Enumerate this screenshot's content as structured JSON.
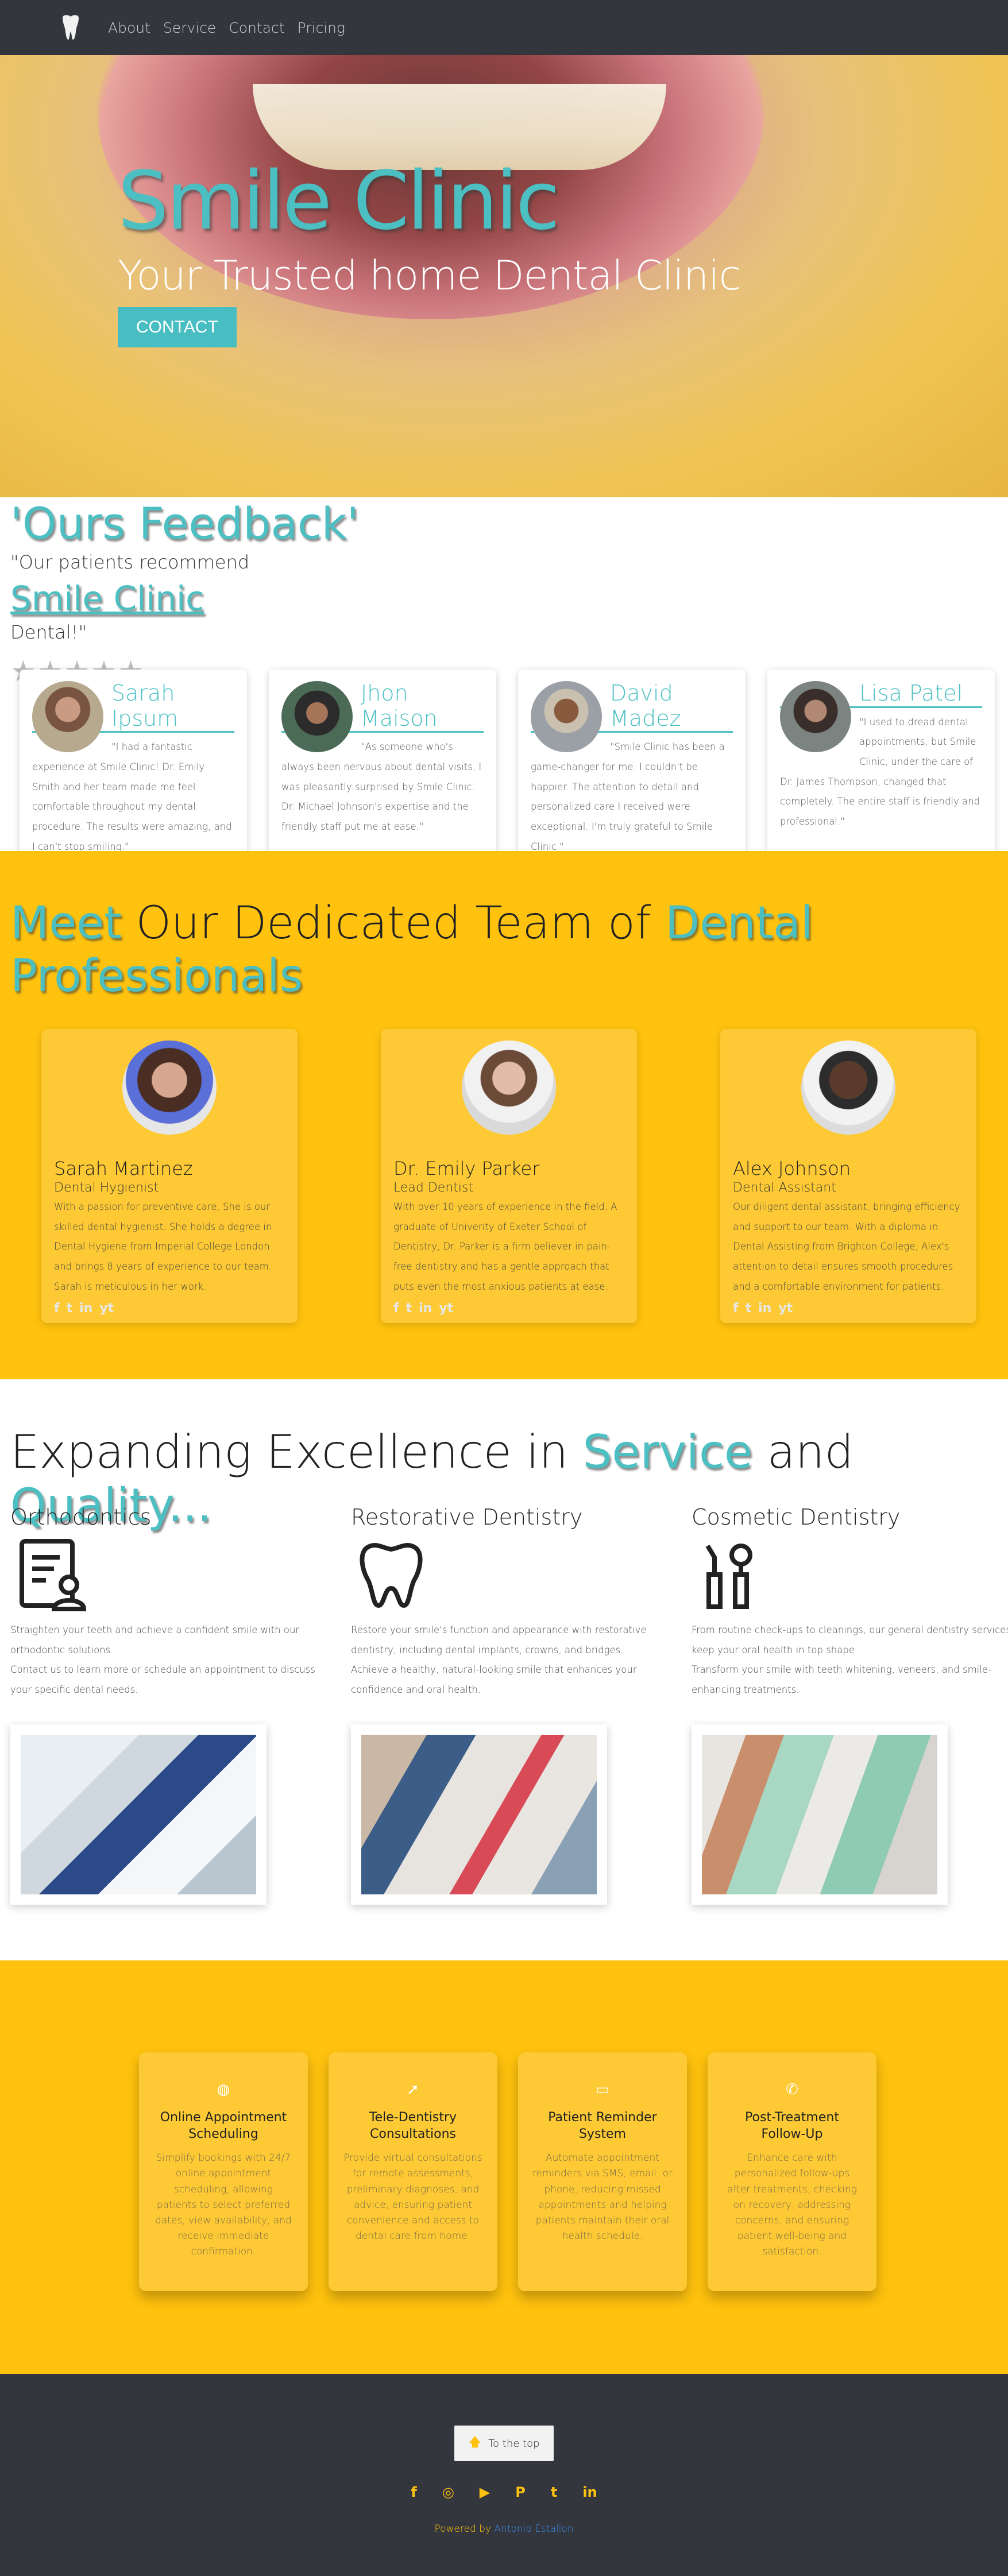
{
  "nav": {
    "logo": "tooth-logo",
    "links": [
      "About",
      "Service",
      "Contact",
      "Pricing"
    ]
  },
  "hero": {
    "title": "Smile Clinic",
    "subtitle": "Your Trusted home Dental Clinic",
    "cta": "CONTACT"
  },
  "feedback": {
    "title": "'Ours Feedback'",
    "recommend": "\"Our patients recommend",
    "brand": "Smile Clinic",
    "dental": "Dental!\"",
    "stars": "★★★★★",
    "reviews": [
      {
        "name": "Sarah Ipsum",
        "text": "\"I had a fantastic experience at Smile Clinic! Dr. Emily Smith and her team made me feel comfortable throughout my dental procedure. The results were amazing, and I can't stop smiling.\""
      },
      {
        "name": "Jhon Maison",
        "text": "\"As someone who's always been nervous about dental visits, I was pleasantly surprised by Smile Clinic. Dr. Michael Johnson's expertise and the friendly staff put me at ease.\""
      },
      {
        "name": "David Madez",
        "text": "\"Smile Clinic has been a game-changer for me. I couldn't be happier. The attention to detail and personalized care I received were exceptional. I'm truly grateful to Smile Clinic.\""
      },
      {
        "name": "Lisa Patel",
        "text": "\"I used to dread dental appointments, but Smile Clinic, under the care of Dr. James Thompson, changed that completely. The entire staff is friendly and professional.\""
      }
    ]
  },
  "team": {
    "title_meet": "Meet",
    "title_mid": "Our Dedicated Team of",
    "title_dental": "Dental",
    "title_pro": "Professionals",
    "members": [
      {
        "name": "Sarah Martinez",
        "role": "Dental Hygienist",
        "bio": "With a passion for preventive care, She is our skilled dental hygienist. She holds a degree in Dental Hygiene from Imperial College London and brings 8 years of experience to our team. Sarah is meticulous in her work."
      },
      {
        "name": "Dr. Emily Parker",
        "role": "Lead Dentist",
        "bio": "With over 10 years of experience in the field. A graduate of Univerity of Exeter School of Dentistry, Dr. Parker is a firm believer in pain-free dentistry and has a gentle approach that puts even the most anxious patients at ease."
      },
      {
        "name": "Alex Johnson",
        "role": "Dental Assistant",
        "bio": "Our diligent dental assistant, bringing efficiency and support to our team. With a diploma in Dental Assisting from Brighton College, Alex's attention to detail ensures smooth procedures and a comfortable environment for patients."
      }
    ],
    "socials": [
      "f",
      "t",
      "in",
      "yt"
    ]
  },
  "services": {
    "title_a": "Expanding Excellence in",
    "title_service": "Service",
    "title_and": "and",
    "title_quality": "Quality...",
    "cols": [
      {
        "title": "Orthodontics",
        "icon": "clipboard-user-icon",
        "p1": "Straighten your teeth and achieve a confident smile with our orthodontic solutions.",
        "p2": "Contact us to learn more or schedule an appointment to discuss your specific dental needs."
      },
      {
        "title": "Restorative Dentistry",
        "icon": "tooth-icon",
        "p1": "Restore your smile's function and appearance with restorative dentistry, including dental implants, crowns, and bridges.",
        "p2": "Achieve a healthy, natural-looking smile that enhances your confidence and oral health."
      },
      {
        "title": "Cosmetic Dentistry",
        "icon": "dental-tools-icon",
        "p1": "From routine check-ups to cleanings, our general dentistry services keep your oral health in top shape.",
        "p2": "Transform your smile with teeth whitening, veneers, and smile-enhancing treatments."
      }
    ]
  },
  "features": [
    {
      "icon": "globe-icon",
      "glyph": "◍",
      "title": "Online Appointment Scheduling",
      "text": "Simplify bookings with 24/7 online appointment scheduling, allowing patients to select preferred dates, view availability, and receive immediate confirmation."
    },
    {
      "icon": "rocket-icon",
      "glyph": "➚",
      "title": "Tele-Dentistry Consultations",
      "text": "Provide virtual consultations for remote assessments, preliminary diagnoses, and advice, ensuring patient convenience and access to dental care from home."
    },
    {
      "icon": "monitor-icon",
      "glyph": "▭",
      "title": "Patient Reminder System",
      "text": "Automate appointment reminders via SMS, email, or phone, reducing missed appointments and helping patients maintain their oral health schedule."
    },
    {
      "icon": "phone-icon",
      "glyph": "✆",
      "title": "Post-Treatment Follow-Up",
      "text": "Enhance care with personalized follow-ups after treatments, checking on recovery, addressing concerns, and ensuring patient well-being and satisfaction."
    }
  ],
  "footer": {
    "to_top": "To the top",
    "socials": [
      "f",
      "◎",
      "▶",
      "P",
      "t",
      "in"
    ],
    "powered_by": "Powered by",
    "author": "Antonio Estallon"
  },
  "colors": {
    "teal": "#4bbfc2",
    "yellow": "#ffc20e",
    "dark": "#33363d"
  }
}
